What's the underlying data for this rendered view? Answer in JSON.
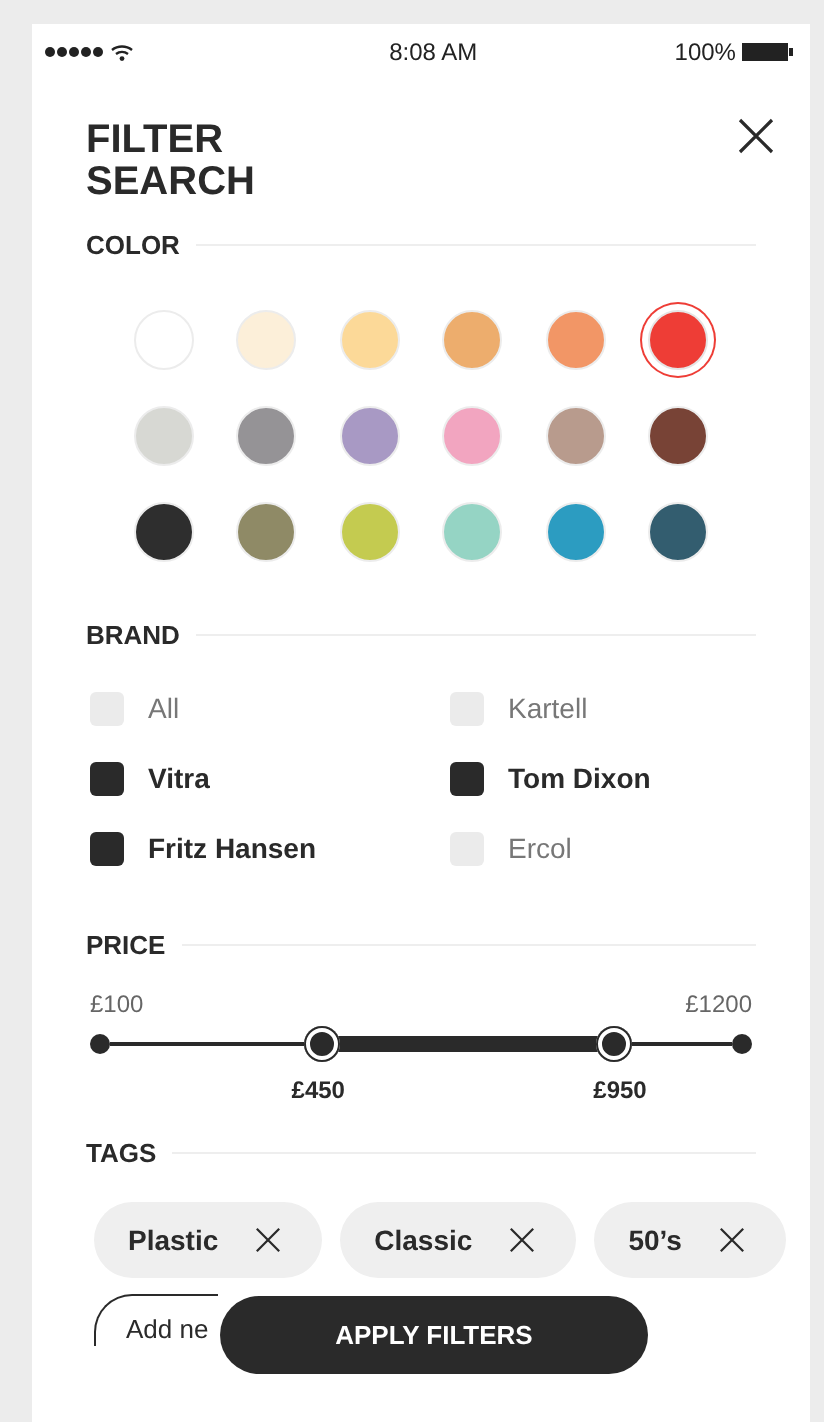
{
  "status_bar": {
    "time": "8:08 AM",
    "battery": "100%"
  },
  "title": "FILTER SEARCH",
  "sections": [
    {
      "kind": "color",
      "heading": "COLOR"
    },
    {
      "kind": "brand",
      "heading": "BRAND"
    },
    {
      "kind": "price",
      "heading": "PRICE"
    },
    {
      "kind": "tags",
      "heading": "TAGS"
    }
  ],
  "colors": [
    {
      "color": "#ffffff",
      "selected": false
    },
    {
      "color": "#fcefd9",
      "selected": false
    },
    {
      "color": "#fcd998",
      "selected": false
    },
    {
      "color": "#edad6d",
      "selected": false
    },
    {
      "color": "#f29666",
      "selected": false
    },
    {
      "color": "#ee3d36",
      "selected": true
    },
    {
      "color": "#d7d8d3",
      "selected": false
    },
    {
      "color": "#959396",
      "selected": false
    },
    {
      "color": "#a899c4",
      "selected": false
    },
    {
      "color": "#f2a5c0",
      "selected": false
    },
    {
      "color": "#b89b8d",
      "selected": false
    },
    {
      "color": "#784336",
      "selected": false
    },
    {
      "color": "#2e2e2e",
      "selected": false
    },
    {
      "color": "#8f8a66",
      "selected": false
    },
    {
      "color": "#c4cb50",
      "selected": false
    },
    {
      "color": "#95d4c4",
      "selected": false
    },
    {
      "color": "#2c9cc1",
      "selected": false
    },
    {
      "color": "#335d6f",
      "selected": false
    }
  ],
  "brands": [
    {
      "label": "All",
      "checked": false
    },
    {
      "label": "Kartell",
      "checked": false
    },
    {
      "label": "Vitra",
      "checked": true
    },
    {
      "label": "Tom Dixon",
      "checked": true
    },
    {
      "label": "Fritz Hansen",
      "checked": true
    },
    {
      "label": "Ercol",
      "checked": false
    }
  ],
  "price": {
    "min": "£100",
    "max": "£1200",
    "thumbs": [
      {
        "level": 0.34,
        "value": "£450"
      },
      {
        "level": 0.81,
        "value": "£950"
      }
    ]
  },
  "tags": [
    {
      "label": "Plastic"
    },
    {
      "label": "Classic"
    },
    {
      "label": "50’s"
    }
  ],
  "add_tag": {
    "label": "Add ne"
  },
  "apply_button": "APPLY FILTERS"
}
